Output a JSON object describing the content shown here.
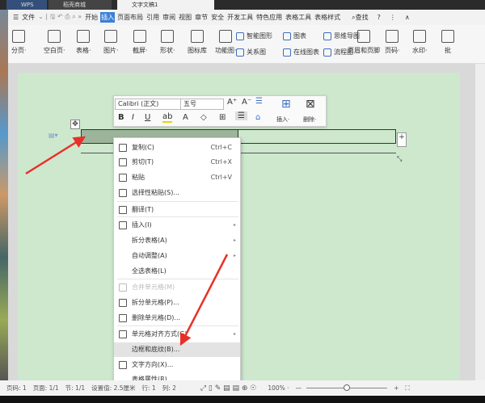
{
  "tabs": [
    "WPS",
    "稻壳商城",
    "文字文稿1"
  ],
  "menu": {
    "file": "文件",
    "items": [
      "开始",
      "插入",
      "页面布局",
      "引用",
      "审阅",
      "视图",
      "章节",
      "安全",
      "开发工具",
      "特色应用",
      "表格工具",
      "表格样式"
    ],
    "active": "插入",
    "search": "查找"
  },
  "ribbon": {
    "big": [
      "分页·",
      "空白页·",
      "表格·",
      "图片·",
      "截屏·",
      "形状·",
      "图标库",
      "功能图·",
      "页眉和页脚",
      "页码·",
      "水印·",
      "批"
    ],
    "small": [
      "智能图形",
      "图表",
      "思维导图",
      "关系图",
      "在线图表",
      "流程图"
    ]
  },
  "mini_toolbar": {
    "font": "Calibri (正文)",
    "size": "五号",
    "insert": "插入·",
    "delete": "删除·"
  },
  "context_menu": [
    {
      "label": "复制(C)",
      "shortcut": "Ctrl+C",
      "icon": "copy-icon"
    },
    {
      "label": "剪切(T)",
      "shortcut": "Ctrl+X",
      "icon": "cut-icon"
    },
    {
      "label": "粘贴",
      "shortcut": "Ctrl+V",
      "icon": "paste-icon"
    },
    {
      "label": "选择性粘贴(S)...",
      "icon": "paste-special-icon"
    },
    {
      "label": "翻译(T)",
      "icon": "translate-icon"
    },
    {
      "label": "插入(I)",
      "icon": "table-insert-icon",
      "submenu": true
    },
    {
      "label": "拆分表格(A)",
      "submenu": true
    },
    {
      "label": "自动调整(A)",
      "submenu": true
    },
    {
      "label": "全选表格(L)"
    },
    {
      "label": "合并单元格(M)",
      "icon": "merge-cells-icon",
      "disabled": true
    },
    {
      "label": "拆分单元格(P)...",
      "icon": "split-cells-icon"
    },
    {
      "label": "删除单元格(D)...",
      "icon": "delete-cells-icon"
    },
    {
      "label": "单元格对齐方式(G)",
      "icon": "cell-align-icon",
      "submenu": true
    },
    {
      "label": "边框和底纹(B)...",
      "highlighted": true
    },
    {
      "label": "文字方向(X)...",
      "icon": "text-direction-icon"
    },
    {
      "label": "表格属性(R)..."
    }
  ],
  "status": {
    "page": "页码: 1",
    "pages": "页面: 1/1",
    "section": "节: 1/1",
    "setting": "设置值: 2.5厘米",
    "row": "行: 1",
    "col": "列: 2",
    "zoom": "100% ·",
    "zoom_level": 100
  },
  "colors": {
    "page": "#cde8cd",
    "selected_cell": "#9cb59a",
    "accent": "#3c7fd6",
    "arrow": "#e8302a"
  }
}
